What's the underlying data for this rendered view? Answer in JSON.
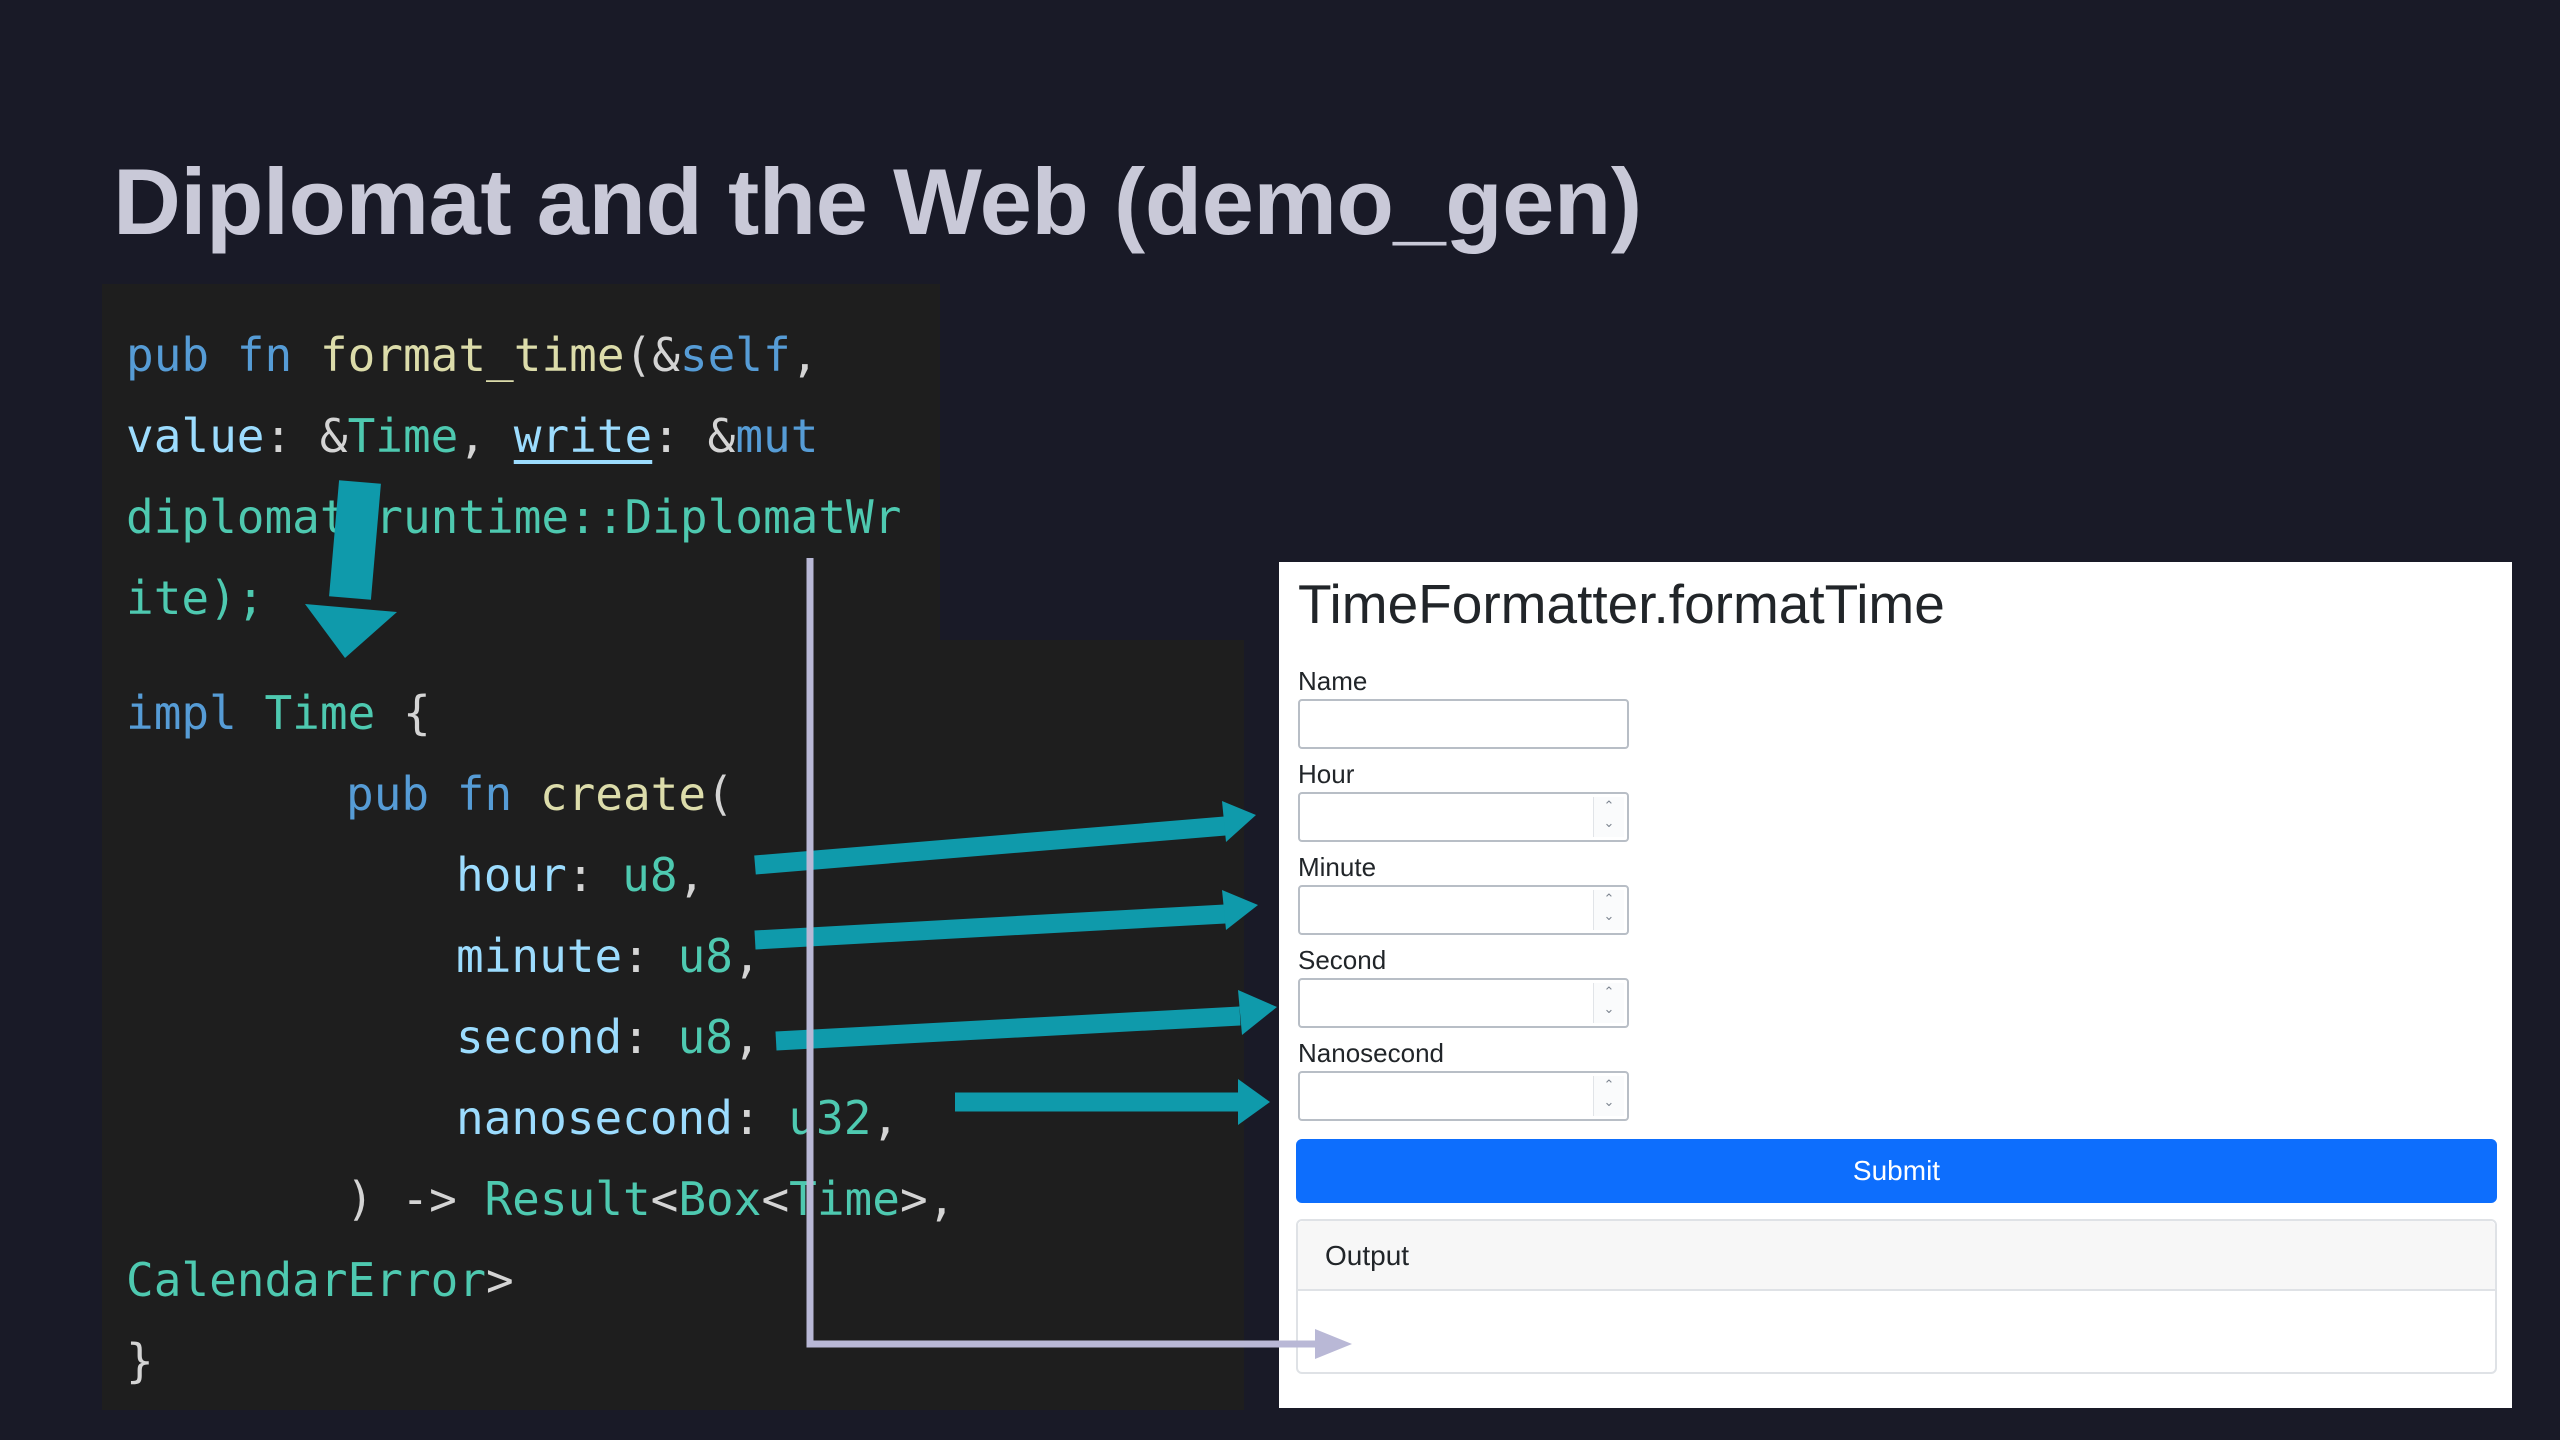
{
  "slide": {
    "title": "Diplomat and the Web (demo_gen)"
  },
  "code": {
    "line1": {
      "kw_pub": "pub",
      "kw_fn": "fn",
      "fn_name": "format_time",
      "open": "(&",
      "self": "self",
      "comma": ","
    },
    "line2": {
      "value": "value",
      "sep1": ": &",
      "time": "Time",
      "sep2": ", ",
      "write": "write",
      "sep3": ": &",
      "mut": "mut"
    },
    "line3": {
      "text": "diplomat_runtime::DiplomatWr"
    },
    "line4": {
      "text": "ite);"
    },
    "line5": {
      "impl": "impl",
      "time": "Time",
      "brace": " {"
    },
    "line6": {
      "pub": "pub",
      "fn": "fn",
      "create": "create",
      "paren": "("
    },
    "line7": {
      "name": "hour",
      "sep": ": ",
      "type": "u8",
      "comma": ","
    },
    "line8": {
      "name": "minute",
      "sep": ": ",
      "type": "u8",
      "comma": ","
    },
    "line9": {
      "name": "second",
      "sep": ": ",
      "type": "u8",
      "comma": ","
    },
    "line10": {
      "name": "nanosecond",
      "sep": ": ",
      "type": "u32",
      "comma": ","
    },
    "line11": {
      "prefix": ") -> ",
      "result": "Result",
      "lt": "<",
      "box": "Box",
      "lt2": "<",
      "time": "Time",
      "end": ">,"
    },
    "line12": {
      "err": "CalendarError",
      "end": ">"
    },
    "line13": {
      "text": "}"
    }
  },
  "form": {
    "title": "TimeFormatter.formatTime",
    "fields": [
      {
        "label": "Name",
        "value": ""
      },
      {
        "label": "Hour",
        "value": ""
      },
      {
        "label": "Minute",
        "value": ""
      },
      {
        "label": "Second",
        "value": ""
      },
      {
        "label": "Nanosecond",
        "value": ""
      }
    ],
    "submit_label": "Submit",
    "output_label": "Output",
    "output_value": "",
    "spinner_up": "⌃",
    "spinner_down": "⌄"
  },
  "colors": {
    "background": "#191a27",
    "code_bg": "#1e1e1e",
    "arrow_teal": "#0f9aab",
    "arrow_grey": "#b9b8d6",
    "submit_blue": "#0d6efd"
  }
}
